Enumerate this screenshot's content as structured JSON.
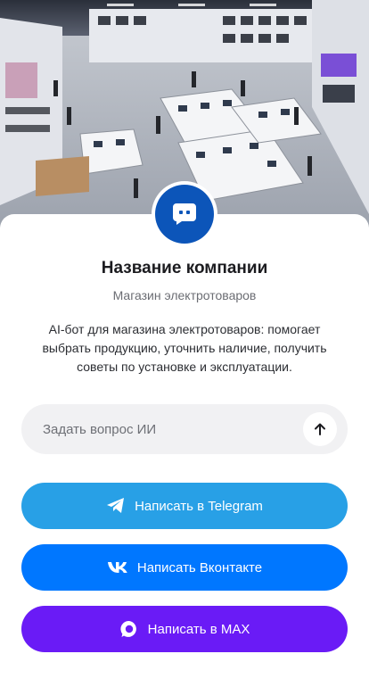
{
  "hero": {
    "image_alt": "Electronics store interior"
  },
  "company": {
    "name": "Название компании",
    "category": "Магазин электротоваров",
    "description": "AI-бот для магазина электротоваров: помогает выбрать продукцию, уточнить наличие, получить советы по установке и эксплуатации."
  },
  "ask": {
    "placeholder": "Задать вопрос ИИ",
    "send_icon": "arrow-up-icon"
  },
  "buttons": {
    "telegram": {
      "label": "Написать в Telegram",
      "icon": "telegram-icon",
      "color": "#28a0e6"
    },
    "vk": {
      "label": "Написать Вконтакте",
      "icon": "vk-icon",
      "color": "#0077ff"
    },
    "max": {
      "label": "Написать в MAX",
      "icon": "max-icon",
      "color": "#6a1bf6"
    }
  },
  "colors": {
    "avatar_bg": "#0c55b9"
  }
}
